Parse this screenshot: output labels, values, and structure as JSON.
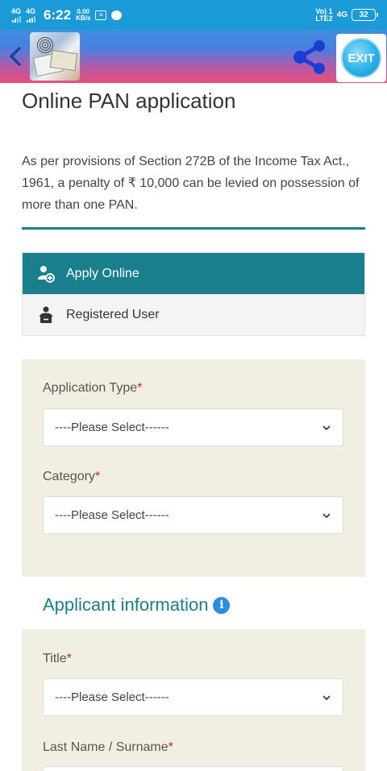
{
  "status_bar": {
    "signal1": "4G",
    "signal2": "4G",
    "time": "6:22",
    "speed_value": "0.00",
    "speed_unit": "KB/s",
    "volte_line1": "Vo) 1",
    "volte_line2": "LTE2",
    "network": "4G",
    "battery": "32"
  },
  "header": {
    "back_icon": "chevron-left-icon",
    "share_icon": "share-icon",
    "exit_label": "EXIT",
    "colors": {
      "gradient_top": "#3f8fe0",
      "gradient_bottom": "#e8507a",
      "share": "#1a3fd0"
    }
  },
  "page": {
    "title": "Online PAN application",
    "notice": "As per provisions of Section 272B of the Income Tax Act., 1961, a penalty of ₹ 10,000 can be levied on possession of more than one PAN."
  },
  "tabs": [
    {
      "label": "Apply Online",
      "icon": "add-user-icon",
      "active": true
    },
    {
      "label": "Registered User",
      "icon": "user-card-icon",
      "active": false
    }
  ],
  "form": {
    "application_type": {
      "label": "Application Type",
      "required_mark": "*",
      "value": "----Please Select------"
    },
    "category": {
      "label": "Category",
      "required_mark": "*",
      "value": "----Please Select------"
    }
  },
  "applicant": {
    "section_title": "Applicant information",
    "info_icon_glyph": "i",
    "title_field": {
      "label": "Title",
      "required_mark": "*",
      "value": "----Please Select------"
    },
    "last_name": {
      "label": "Last Name / Surname",
      "required_mark": "*"
    }
  },
  "colors": {
    "accent": "#1a7f8c",
    "status_bar": "#1a9bd7",
    "panel_bg": "#f1efe2",
    "required": "#c62828"
  }
}
